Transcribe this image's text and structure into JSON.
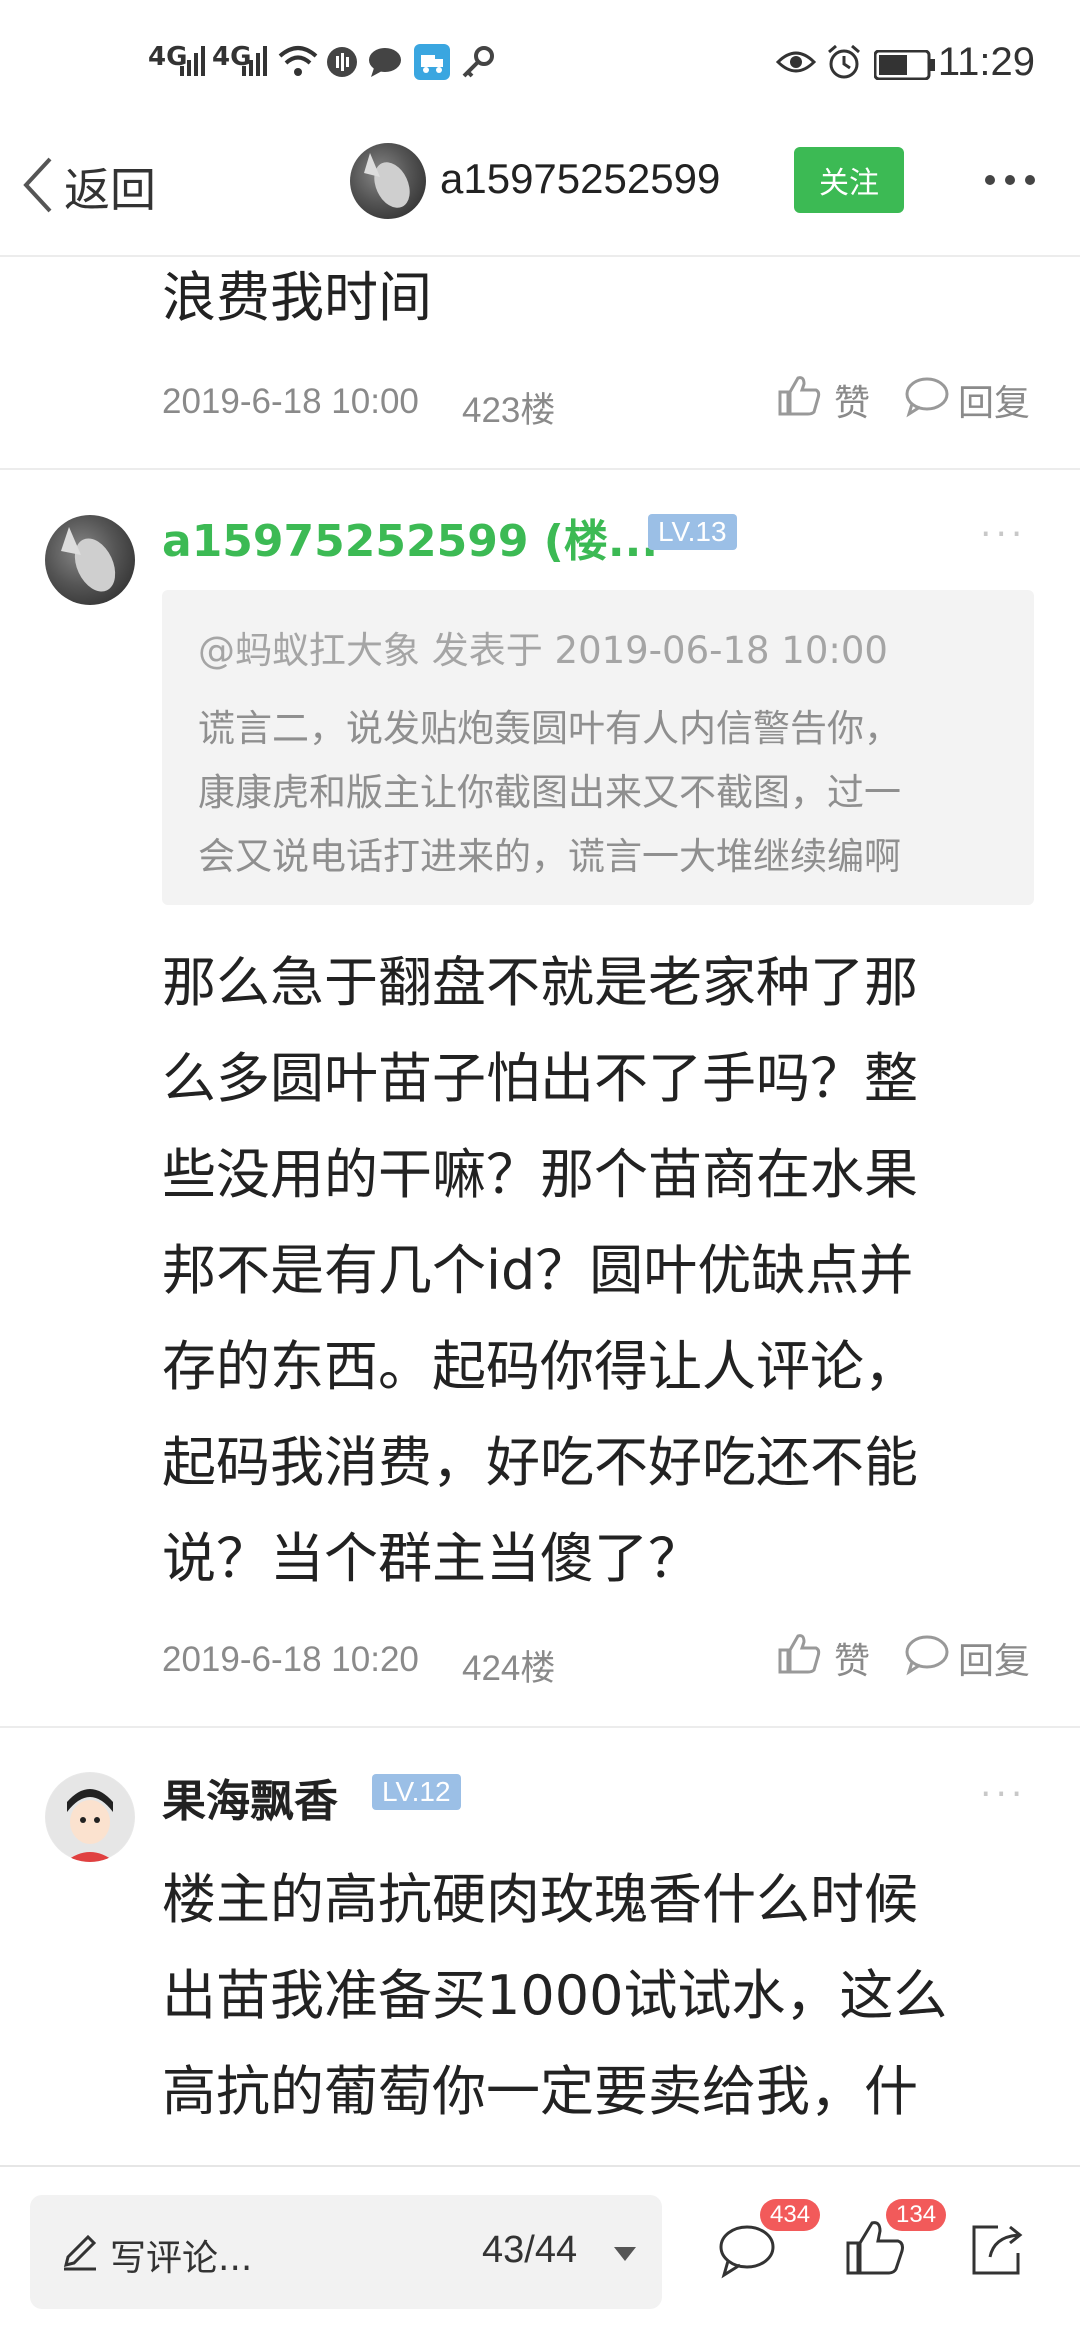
{
  "status_bar": {
    "net1": "4G",
    "net2": "4G",
    "time": "11:29"
  },
  "nav": {
    "back_label": "返回",
    "username": "a15975252599",
    "follow_label": "关注"
  },
  "posts": [
    {
      "text": "浪费我时间",
      "time": "2019-6-18 10:00",
      "floor": "423楼",
      "like_label": "赞",
      "reply_label": "回复"
    },
    {
      "author": "a15975252599 (楼...",
      "level": "LV.13",
      "quote_header": "@蚂蚁扛大象 发表于 2019-06-18 10:00",
      "quote_lines": [
        "谎言二，说发贴炮轰圆叶有人内信警告你，",
        "康康虎和版主让你截图出来又不截图，过一",
        "会又说电话打进来的，谎言一大堆继续编啊"
      ],
      "lines": [
        "那么急于翻盘不就是老家种了那",
        "么多圆叶苗子怕出不了手吗？整",
        "些没用的干嘛？那个苗商在水果",
        "邦不是有几个id？圆叶优缺点并",
        "存的东西。起码你得让人评论，",
        "起码我消费，好吃不好吃还不能",
        "说？当个群主当傻了？"
      ],
      "time": "2019-6-18 10:20",
      "floor": "424楼",
      "like_label": "赞",
      "reply_label": "回复"
    },
    {
      "author": "果海飘香",
      "level": "LV.12",
      "lines": [
        "楼主的高抗硬肉玫瑰香什么时候",
        "出苗我准备买1000试试水，这么",
        "高抗的葡萄你一定要卖给我，什"
      ]
    }
  ],
  "bottom_bar": {
    "comment_placeholder": "写评论...",
    "page_indicator": "43/44",
    "comment_count": "434",
    "like_count": "134"
  },
  "colors": {
    "accent_green": "#3cba54",
    "level_badge": "#9bbfe6",
    "badge_red": "#f25a5a"
  }
}
